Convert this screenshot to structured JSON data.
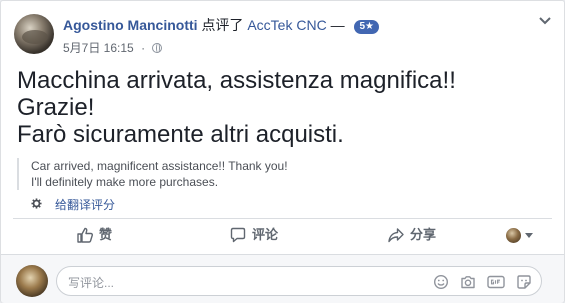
{
  "post": {
    "author": "Agostino Mancinotti",
    "action": "点评了",
    "page": "AccTek CNC",
    "dash": "—",
    "rating": "5★",
    "date": "5月7日 16:15",
    "dot": "·",
    "text": [
      "Macchina arrivata, assistenza magnifica!!",
      "Grazie!",
      "Farò sicuramente altri acquisti."
    ],
    "translation": [
      "Car arrived, magnificent assistance!! Thank you!",
      "I'll definitely make more purchases."
    ],
    "rate_translation": "给翻译评分"
  },
  "actions": {
    "like": "赞",
    "comment": "评论",
    "share": "分享"
  },
  "composer": {
    "placeholder": "写评论..."
  },
  "colors": {
    "link": "#365899",
    "badge": "#4267b2",
    "muted": "#606770"
  }
}
